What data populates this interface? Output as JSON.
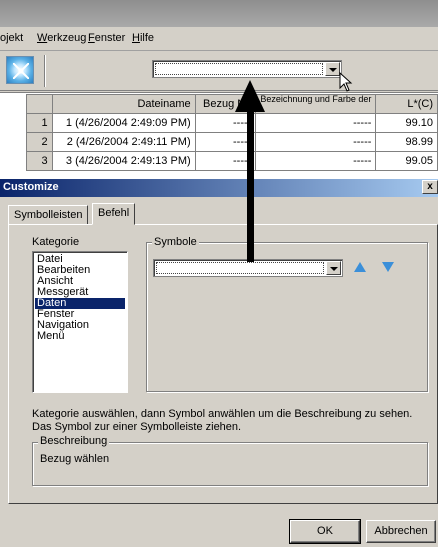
{
  "menubar": {
    "items": [
      {
        "label": "ojekt"
      },
      {
        "label": "Werkzeug"
      },
      {
        "label": "Fenster"
      },
      {
        "label": "Hilfe"
      }
    ]
  },
  "grid": {
    "columns": [
      "",
      "Dateiname",
      "Bezug Nr.",
      "Bezeichnung und Farbe der",
      "L*(C)"
    ],
    "rows": [
      {
        "num": "1",
        "name": "1 (4/26/2004 2:49:09 PM)",
        "bezug": "-----",
        "bez": "-----",
        "l": "99.10"
      },
      {
        "num": "2",
        "name": "2 (4/26/2004 2:49:11 PM)",
        "bezug": "-----",
        "bez": "-----",
        "l": "98.99"
      },
      {
        "num": "3",
        "name": "3 (4/26/2004 2:49:13 PM)",
        "bezug": "-----",
        "bez": "-----",
        "l": "99.05"
      }
    ]
  },
  "dialog": {
    "title": "Customize",
    "close": "x",
    "tabs": [
      {
        "label": "Symbolleisten"
      },
      {
        "label": "Befehl"
      }
    ],
    "kategorie_label": "Kategorie",
    "symbole_label": "Symbole",
    "categories": [
      "Datei",
      "Bearbeiten",
      "Ansicht",
      "Messgerät",
      "Daten",
      "Fenster",
      "Navigation",
      "Menü"
    ],
    "selected_category": "Daten",
    "instructions": "Kategorie auswählen, dann Symbol anwählen um die Beschreibung zu sehen. Das Symbol zur einer Symbolleiste ziehen.",
    "beschreibung_label": "Beschreibung",
    "beschreibung_text": "Bezug wählen",
    "ok_label": "OK",
    "cancel_label": "Abbrechen"
  },
  "colors": {
    "dialog_bg": "#d4d0c8",
    "title_start": "#0a246a",
    "title_end": "#a6caf0",
    "up_arrow": "#3b8fd9",
    "down_arrow": "#3b8fd9"
  }
}
